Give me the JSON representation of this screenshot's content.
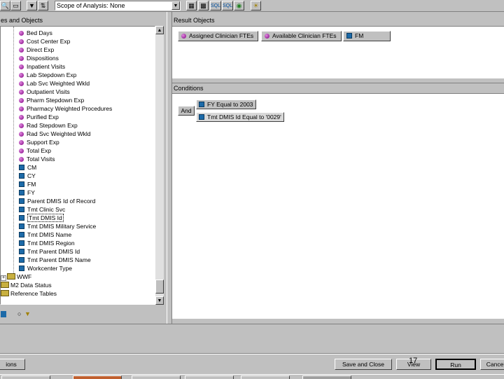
{
  "toolbar": {
    "scope_label": "Scope of Analysis: None",
    "icons": [
      "funnel-icon",
      "sort-icon",
      "sql-icon",
      "sql-alt-icon",
      "web-icon",
      "bulb-icon"
    ]
  },
  "left_panel": {
    "header": "es and Objects",
    "measures": [
      "Bed Days",
      "Cost Center Exp",
      "Direct Exp",
      "Dispositions",
      "Inpatient Visits",
      "Lab Stepdown Exp",
      "Lab Svc Weighted Wkld",
      "Outpatient Visits",
      "Pharm Stepdown Exp",
      "Pharmacy Weighted Procedures",
      "Purified Exp",
      "Rad Stepdown Exp",
      "Rad Svc Weighted Wkld",
      "Support Exp",
      "Total Exp",
      "Total Visits"
    ],
    "dimensions": [
      "CM",
      "CY",
      "FM",
      "FY",
      "Parent DMIS Id of Record",
      "Tmt Clinic Svc",
      "Tmt DMIS Id",
      "Tmt DMIS Military Service",
      "Tmt DMIS Name",
      "Tmt DMIS Region",
      "Tmt Parent DMIS Id",
      "Tmt Parent DMIS Name",
      "Workcenter Type"
    ],
    "folders": [
      "WWF",
      "M2 Data Status",
      "Reference Tables"
    ]
  },
  "result_objects": {
    "header": "Result Objects",
    "chips": [
      {
        "label": "Assigned Clinician FTEs",
        "icon": "measure"
      },
      {
        "label": "Available Clinician FTEs",
        "icon": "measure"
      },
      {
        "label": "FM",
        "icon": "dimension"
      }
    ]
  },
  "conditions": {
    "header": "Conditions",
    "operator": "And",
    "items": [
      "FY Equal to 2003",
      "Tmt DMIS Id Equal to '0029'"
    ]
  },
  "bottom_buttons": {
    "left": "ions",
    "save": "Save and Close",
    "view": "View",
    "run": "Run",
    "cancel": "Cancel"
  },
  "page_number": "17"
}
